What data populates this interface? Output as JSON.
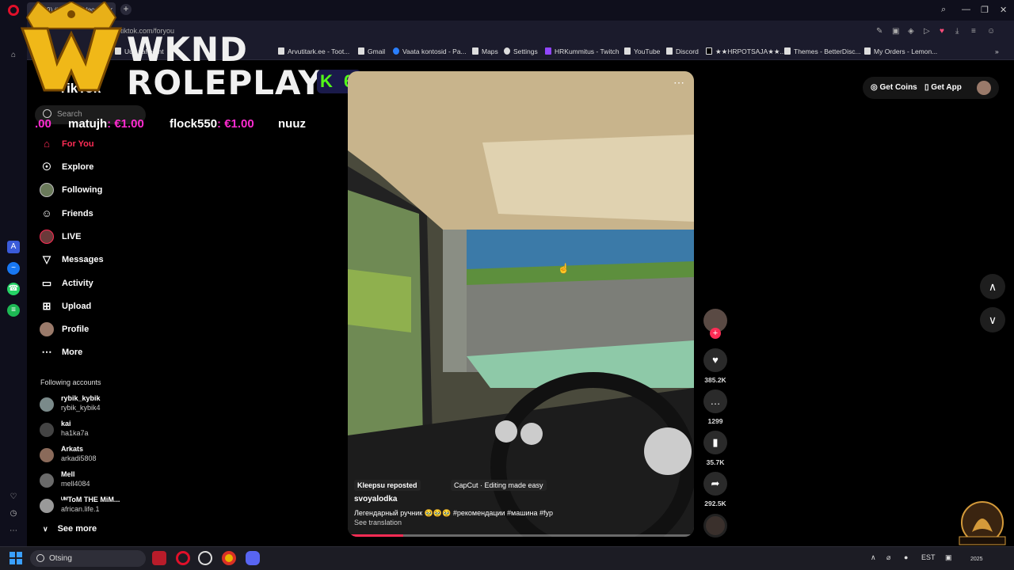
{
  "browser": {
    "tab_title": "(49) #tiktok... video",
    "tab_close": "x",
    "new_tab": "+",
    "url": "tiktok.com/foryou",
    "window_controls": [
      "search-icon",
      "minimize-icon",
      "restore-icon",
      "close-icon"
    ],
    "bookmarks": [
      "Uus vaheleht",
      "Arvutitark.ee - Toot...",
      "Gmail",
      "Vaata kontosid - Pa...",
      "Maps",
      "Settings",
      "HRKummitus - Twitch",
      "YouTube",
      "Discord",
      "★★HRPOTSAJA★★...",
      "Themes - BetterDisc...",
      "My Orders - Lemon..."
    ]
  },
  "overlay": {
    "logo_line1": "WKND",
    "logo_line2": "ROLEPLAY",
    "kick_count": "6",
    "ticker": [
      {
        "name": "",
        "amount": ".00"
      },
      {
        "name": "matujh",
        "amount": ": €1.00"
      },
      {
        "name": "flock550",
        "amount": ": €1.00"
      },
      {
        "name": "nuuz",
        "amount": ""
      }
    ]
  },
  "sidebar": {
    "logo": "TikTok",
    "search_placeholder": "Search",
    "nav": [
      {
        "label": "For You",
        "icon": "home-icon"
      },
      {
        "label": "Explore",
        "icon": "compass-icon"
      },
      {
        "label": "Following",
        "icon": "following-avatar-icon"
      },
      {
        "label": "Friends",
        "icon": "friends-icon"
      },
      {
        "label": "LIVE",
        "icon": "live-icon"
      },
      {
        "label": "Messages",
        "icon": "messages-icon"
      },
      {
        "label": "Activity",
        "icon": "activity-icon"
      },
      {
        "label": "Upload",
        "icon": "upload-icon"
      },
      {
        "label": "Profile",
        "icon": "profile-avatar-icon"
      },
      {
        "label": "More",
        "icon": "more-icon"
      }
    ],
    "following_title": "Following accounts",
    "following": [
      {
        "name": "rybik_kybik",
        "handle": "rybik_kybik4"
      },
      {
        "name": "kai",
        "handle": "ha1ka7a"
      },
      {
        "name": "Arkats",
        "handle": "arkadi5808"
      },
      {
        "name": "Mell",
        "handle": "mell4084"
      },
      {
        "name": "ᵁᴹToM THE MiM...",
        "handle": "african.life.1"
      }
    ],
    "see_more": "See more"
  },
  "video": {
    "reposted": "Kleepsu reposted",
    "capcut": "CapCut · Editing made easy",
    "author": "svoyalodka",
    "caption": "Легендарный ручник 🥹🥹🥹 #рекомендации #машина #fyp",
    "see_translation": "See translation",
    "progress": 0.16
  },
  "actions": {
    "likes": "385.2K",
    "comments": "1299",
    "saves": "35.7K",
    "shares": "292.5K"
  },
  "topright": {
    "get_coins": "Get Coins",
    "get_app": "Get App"
  },
  "taskbar": {
    "search": "Otsing",
    "lang": "EST",
    "date_fragment": "2025"
  },
  "colors": {
    "accent": "#fe2c55",
    "ticker_amount": "#ff2bd1",
    "kick_green": "#53fc18"
  }
}
